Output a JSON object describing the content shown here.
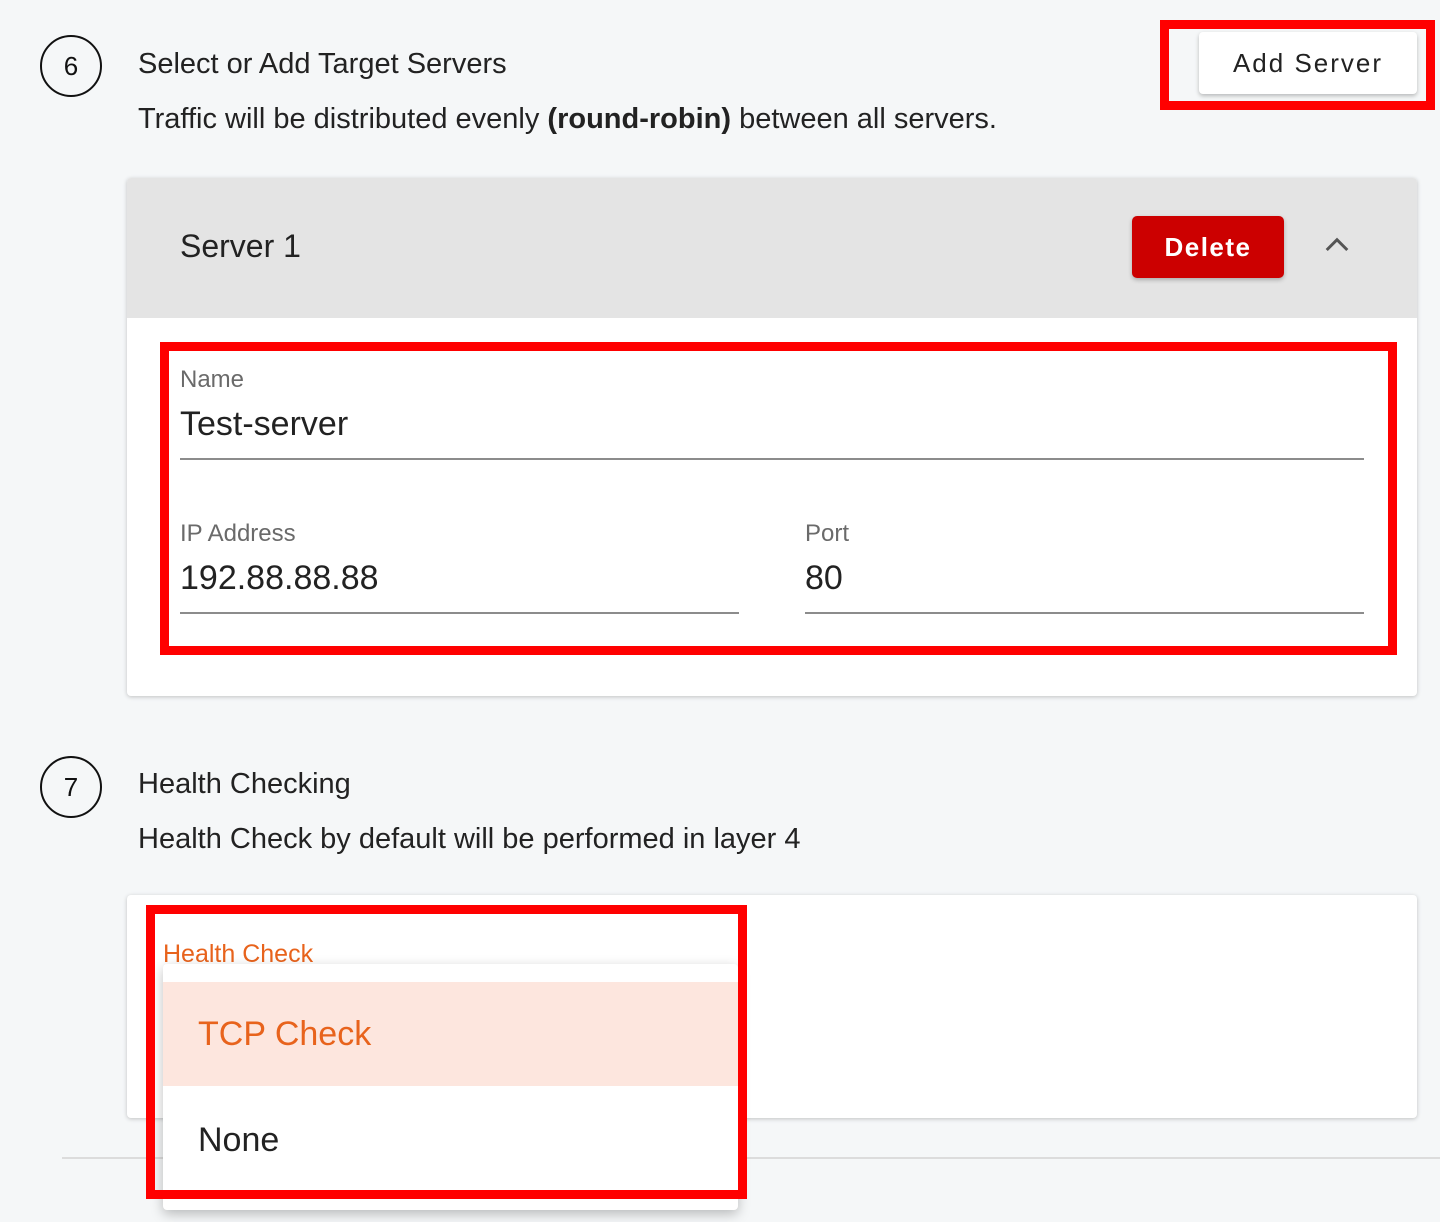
{
  "step6": {
    "number": "6",
    "title": "Select or Add Target Servers",
    "desc_before": "Traffic will be distributed evenly ",
    "desc_bold": "(round-robin)",
    "desc_after": " between all servers.",
    "add_button": "Add Server"
  },
  "server": {
    "title": "Server 1",
    "delete_button": "Delete",
    "collapse_icon": "chevron-up-icon",
    "name": {
      "label": "Name",
      "value": "Test-server"
    },
    "ip": {
      "label": "IP Address",
      "value": "192.88.88.88"
    },
    "port": {
      "label": "Port",
      "value": "80"
    }
  },
  "step7": {
    "number": "7",
    "title": "Health Checking",
    "desc": "Health Check by default will be performed in layer 4"
  },
  "health_check": {
    "label": "Health Check",
    "options": [
      {
        "label": "TCP Check",
        "selected": true
      },
      {
        "label": "None",
        "selected": false
      }
    ]
  },
  "colors": {
    "highlight": "#ff0000",
    "delete": "#cc0000",
    "accent": "#e8631c",
    "selected_bg": "#fde6de"
  }
}
